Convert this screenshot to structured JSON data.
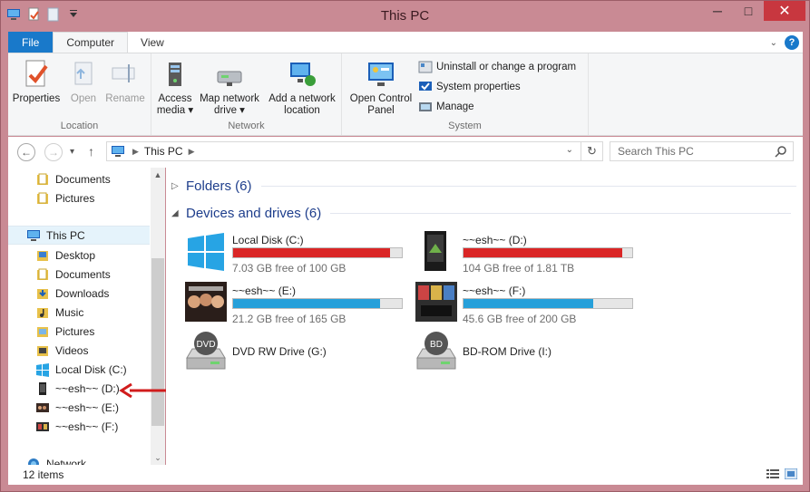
{
  "window": {
    "title": "This PC"
  },
  "titlebar": {
    "minimize": "─",
    "maximize": "□",
    "close": "✕"
  },
  "ribbon_tabs": [
    {
      "label": "File"
    },
    {
      "label": "Computer"
    },
    {
      "label": "View"
    }
  ],
  "ribbon": {
    "location": {
      "label": "Location",
      "properties": "Properties",
      "open": "Open",
      "rename": "Rename"
    },
    "network": {
      "label": "Network",
      "access_media": [
        "Access",
        "media ▾"
      ],
      "map_drive": [
        "Map network",
        "drive ▾"
      ],
      "add_location": [
        "Add a network",
        "location"
      ]
    },
    "system": {
      "label": "System",
      "control_panel": [
        "Open Control",
        "Panel"
      ],
      "uninstall": "Uninstall or change a program",
      "sys_props": "System properties",
      "manage": "Manage"
    }
  },
  "address": {
    "back": "←",
    "forward": "→",
    "recent": "▾",
    "up": "↑",
    "path": "This PC",
    "refresh": "↻"
  },
  "search": {
    "placeholder": "Search This PC"
  },
  "nav_pane": {
    "items": [
      {
        "label": "Documents"
      },
      {
        "label": "Pictures"
      },
      {
        "label": "This PC"
      },
      {
        "label": "Desktop"
      },
      {
        "label": "Documents"
      },
      {
        "label": "Downloads"
      },
      {
        "label": "Music"
      },
      {
        "label": "Pictures"
      },
      {
        "label": "Videos"
      },
      {
        "label": "Local Disk (C:)"
      },
      {
        "label": "~~esh~~ (D:)"
      },
      {
        "label": "~~esh~~ (E:)"
      },
      {
        "label": "~~esh~~ (F:)"
      },
      {
        "label": "Network"
      }
    ]
  },
  "content": {
    "folders_header": "Folders (6)",
    "devices_header": "Devices and drives (6)",
    "drives": [
      {
        "name": "Local Disk (C:)",
        "free": "7.03 GB free of 100 GB",
        "used_fraction": 0.93,
        "bar_color": "#da2626"
      },
      {
        "name": "~~esh~~ (D:)",
        "free": "104 GB free of 1.81 TB",
        "used_fraction": 0.94,
        "bar_color": "#da2626"
      },
      {
        "name": "~~esh~~ (E:)",
        "free": "21.2 GB free of 165 GB",
        "used_fraction": 0.87,
        "bar_color": "#26a0da"
      },
      {
        "name": "~~esh~~ (F:)",
        "free": "45.6 GB free of 200 GB",
        "used_fraction": 0.77,
        "bar_color": "#26a0da"
      },
      {
        "name": "DVD RW Drive (G:)"
      },
      {
        "name": "BD-ROM Drive (I:)"
      }
    ],
    "dvd_badge": "DVD",
    "bd_badge": "BD"
  },
  "status": {
    "items": "12 items"
  }
}
